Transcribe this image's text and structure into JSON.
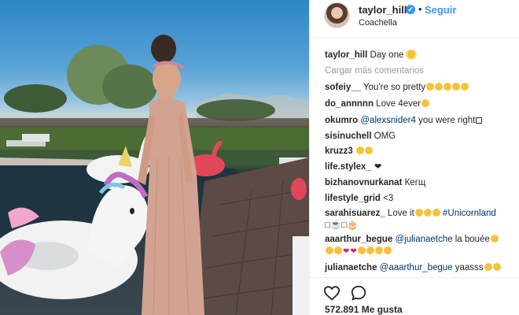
{
  "post": {
    "username": "taylor_hill",
    "verified_icon": "✓",
    "separator": "•",
    "follow_label": "Seguir",
    "location": "Coachella",
    "caption_user": "taylor_hill",
    "caption_text": "Day one",
    "load_more_label": "Cargar más comentarios",
    "likes": "572.891 Me gusta"
  },
  "comments": [
    {
      "user": "sofeiy__",
      "text": "You're so pretty",
      "emojis": [
        "face",
        "face",
        "face",
        "face",
        "face"
      ]
    },
    {
      "user": "do_annnnn",
      "text": "Love 4ever",
      "emojis": [
        "face"
      ]
    },
    {
      "user": "okumro",
      "mention": "@alexsnider4",
      "text": "you were right",
      "emojis": [
        "box"
      ]
    },
    {
      "user": "sisinuchell",
      "text": "OMG",
      "emojis": []
    },
    {
      "user": "kruzz3",
      "text": "",
      "emojis": [
        "face",
        "face"
      ]
    },
    {
      "user": "life.stylex_",
      "text": "",
      "emojis": [
        "black-heart"
      ]
    },
    {
      "user": "bizhanovnurkanat",
      "text": "Кегщ",
      "emojis": []
    },
    {
      "user": "lifestyle_grid",
      "text": "<3",
      "emojis": []
    },
    {
      "user": "sarahisuarez_",
      "text": "Love it",
      "emojis": [
        "face",
        "face",
        "face"
      ],
      "tag": "#Unicornland",
      "extra_line": "□☕□🎂"
    },
    {
      "user": "aaarthur_begue",
      "mention": "@julianaetche",
      "text": "la bouée",
      "emojis": [
        "face"
      ],
      "extra_emojis": [
        "face",
        "face",
        "heart",
        "heart",
        "face",
        "face",
        "face",
        "face"
      ]
    },
    {
      "user": "julianaetche",
      "mention": "@aaarthur_begue",
      "text": "yaasss",
      "emojis": [
        "face",
        "face"
      ]
    }
  ],
  "icons": [
    "heart-outline-icon",
    "comment-bubble-icon",
    "verified-badge-icon",
    "sun-emoji-icon"
  ],
  "colors": {
    "link_blue": "#3897f0",
    "mention_blue": "#003569",
    "border": "#efefef",
    "muted": "#999999"
  }
}
